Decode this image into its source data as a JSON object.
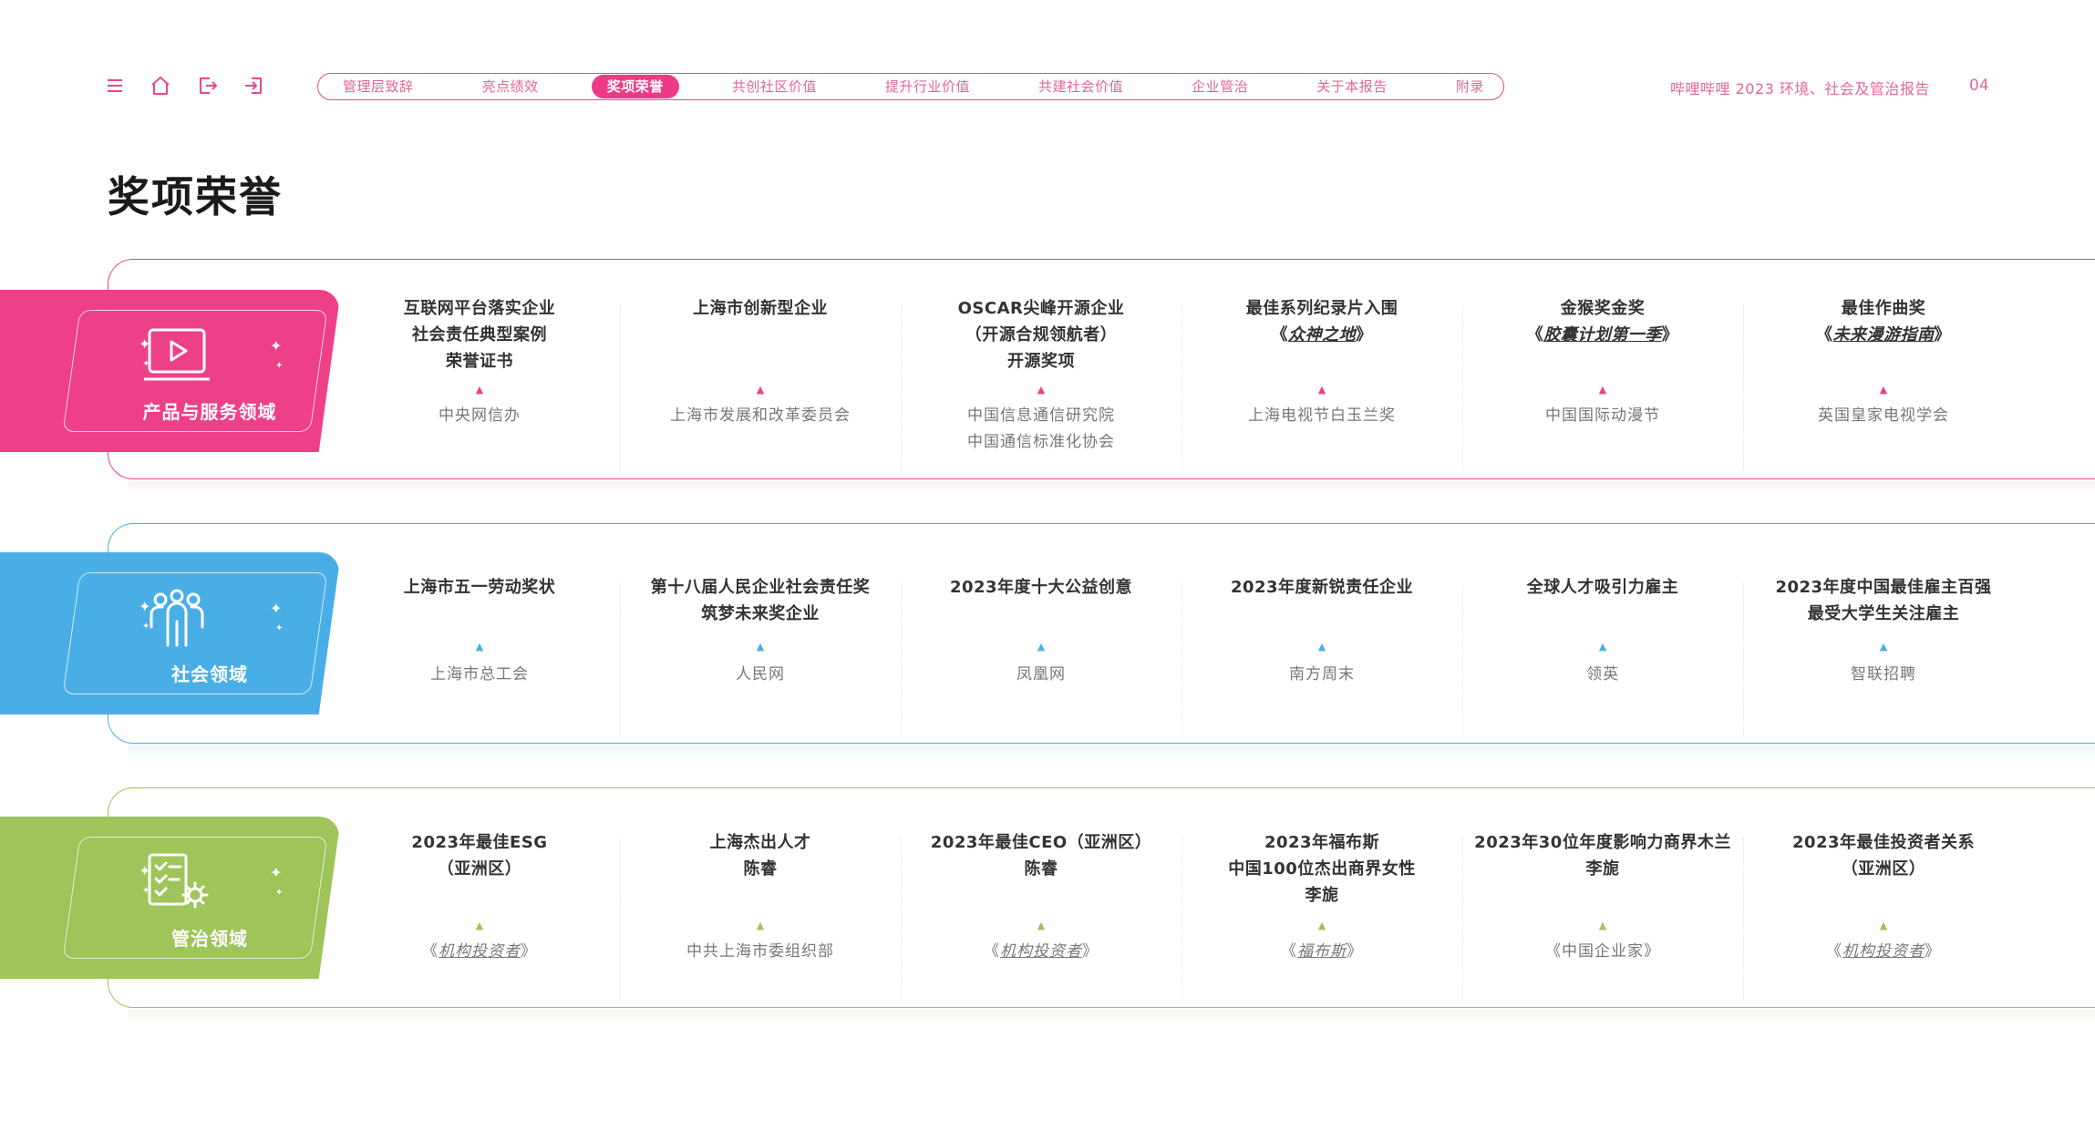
{
  "toolbar": {
    "icons": [
      "menu-icon",
      "home-icon",
      "exit-icon",
      "enter-icon"
    ],
    "accent_color": "#ee3a86"
  },
  "nav": {
    "tabs": [
      {
        "label": "管理层致辞",
        "active": false
      },
      {
        "label": "亮点绩效",
        "active": false
      },
      {
        "label": "奖项荣誉",
        "active": true
      },
      {
        "label": "共创社区价值",
        "active": false
      },
      {
        "label": "提升行业价值",
        "active": false
      },
      {
        "label": "共建社会价值",
        "active": false
      },
      {
        "label": "企业管治",
        "active": false
      },
      {
        "label": "关于本报告",
        "active": false
      },
      {
        "label": "附录",
        "active": false
      }
    ]
  },
  "header": {
    "report_title": "哔哩哔哩 2023 环境、社会及管治报告",
    "page_number": "04"
  },
  "page_title": "奖项荣誉",
  "sections": [
    {
      "label": "产品与服务领域",
      "icon": "video-screen-icon",
      "color": "#ee4086",
      "awards": [
        {
          "title": [
            "互联网平台落实企业",
            "社会责任典型案例",
            "荣誉证书"
          ],
          "source": [
            "中央网信办"
          ]
        },
        {
          "title": [
            "上海市创新型企业"
          ],
          "source": [
            "上海市发展和改革委员会"
          ]
        },
        {
          "title": [
            "OSCAR尖峰开源企业",
            "（开源合规领航者）",
            "开源奖项"
          ],
          "source": [
            "中国信息通信研究院",
            "中国通信标准化协会"
          ]
        },
        {
          "title": [
            "最佳系列纪录片入围",
            "《|众神之地|》"
          ],
          "source": [
            "上海电视节白玉兰奖"
          ]
        },
        {
          "title": [
            "金猴奖金奖",
            "《|胶囊计划第一季|》"
          ],
          "source": [
            "中国国际动漫节"
          ]
        },
        {
          "title": [
            "最佳作曲奖",
            "《|未来漫游指南|》"
          ],
          "source": [
            "英国皇家电视学会"
          ]
        }
      ]
    },
    {
      "label": "社会领域",
      "icon": "people-icon",
      "color": "#4aaee6",
      "awards": [
        {
          "title": [
            "上海市五一劳动奖状"
          ],
          "source": [
            "上海市总工会"
          ]
        },
        {
          "title": [
            "第十八届人民企业社会责任奖",
            "筑梦未来奖企业"
          ],
          "source": [
            "人民网"
          ]
        },
        {
          "title": [
            "2023年度十大公益创意"
          ],
          "source": [
            "凤凰网"
          ]
        },
        {
          "title": [
            "2023年度新锐责任企业"
          ],
          "source": [
            "南方周末"
          ]
        },
        {
          "title": [
            "全球人才吸引力雇主"
          ],
          "source": [
            "领英"
          ]
        },
        {
          "title": [
            "2023年度中国最佳雇主百强",
            "最受大学生关注雇主"
          ],
          "source": [
            "智联招聘"
          ]
        }
      ]
    },
    {
      "label": "管治领域",
      "icon": "checklist-gear-icon",
      "color": "#9ec45a",
      "awards": [
        {
          "title": [
            "2023年最佳ESG",
            "（亚洲区）"
          ],
          "source": [
            "《|机构投资者|》"
          ]
        },
        {
          "title": [
            "上海杰出人才",
            "陈睿"
          ],
          "source": [
            "中共上海市委组织部"
          ]
        },
        {
          "title": [
            "2023年最佳CEO（亚洲区）",
            "陈睿"
          ],
          "source": [
            "《|机构投资者|》"
          ]
        },
        {
          "title": [
            "2023年福布斯",
            "中国100位杰出商界女性",
            "李旎"
          ],
          "source": [
            "《|福布斯|》"
          ]
        },
        {
          "title": [
            "2023年30位年度影响力商界木兰",
            "李旎"
          ],
          "source": [
            "《中国企业家》"
          ]
        },
        {
          "title": [
            "2023年最佳投资者关系",
            "（亚洲区）"
          ],
          "source": [
            "《|机构投资者|》"
          ]
        }
      ]
    }
  ]
}
